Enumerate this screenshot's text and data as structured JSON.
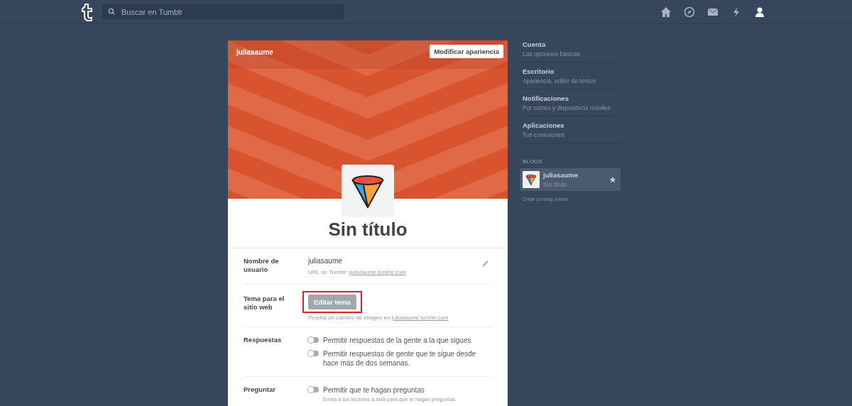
{
  "topbar": {
    "search": {
      "placeholder": "Buscar en Tumblr"
    }
  },
  "blog_card": {
    "blog_name": "juliasaume",
    "customize_button": "Modificar apariencia",
    "title": "Sin título",
    "settings": [
      {
        "kind": "username",
        "label": "Nombre de usuario",
        "value": "juliasaume",
        "url_label": "URL de Tumblr: ",
        "url": "juliasaume.tumblr.com"
      },
      {
        "kind": "theme",
        "label": "Tema para el sitio web",
        "button": "Editar tema",
        "highlighted": true,
        "hint": "Prueba un cambio de imagen en ",
        "url": "juliasaume.tumblr.com"
      },
      {
        "kind": "toggles",
        "label": "Respuestas",
        "toggles": [
          {
            "text": "Permitir respuestas de la gente a la que sigues",
            "on": false
          },
          {
            "text": "Permitir respuestas de gente que te sigue desde hace más de dos semanas.",
            "on": false
          }
        ]
      },
      {
        "kind": "toggles",
        "label": "Preguntar",
        "toggles": [
          {
            "text": "Permitir que te hagan preguntas",
            "on": false,
            "hint": "Envía a tus lectores a /ask para que te hagan preguntas"
          }
        ]
      }
    ]
  },
  "sidebar": {
    "items": [
      {
        "title": "Cuenta",
        "subtitle": "Las opciones básicas"
      },
      {
        "title": "Escritorio",
        "subtitle": "Apariencia, editor de textos"
      },
      {
        "title": "Notificaciones",
        "subtitle": "Por correo y dispositivos móviles"
      },
      {
        "title": "Aplicaciones",
        "subtitle": "Tus conexiones"
      }
    ],
    "blogs_heading": "BLOGS",
    "blogs": [
      {
        "name": "juliasaume",
        "title": "Sin título",
        "selected": true
      }
    ],
    "create_link": "Crear un blog nuevo"
  }
}
